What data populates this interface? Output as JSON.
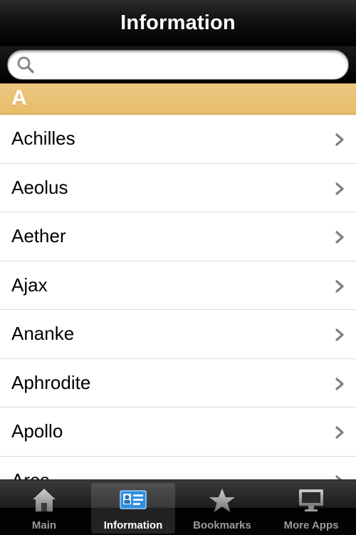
{
  "nav": {
    "title": "Information"
  },
  "search": {
    "placeholder": "",
    "value": ""
  },
  "section": {
    "letter": "A"
  },
  "list": {
    "items": [
      {
        "label": "Achilles"
      },
      {
        "label": "Aeolus"
      },
      {
        "label": "Aether"
      },
      {
        "label": "Ajax"
      },
      {
        "label": "Ananke"
      },
      {
        "label": "Aphrodite"
      },
      {
        "label": "Apollo"
      },
      {
        "label": "Ares"
      }
    ]
  },
  "tabbar": {
    "tabs": [
      {
        "label": "Main",
        "icon": "house-icon"
      },
      {
        "label": "Information",
        "icon": "contact-card-icon",
        "selected": true
      },
      {
        "label": "Bookmarks",
        "icon": "star-icon"
      },
      {
        "label": "More Apps",
        "icon": "monitor-icon"
      }
    ]
  },
  "colors": {
    "section_header": "#e6bd6a",
    "nav_background": "#000000",
    "tab_selected": "#ffffff",
    "tab_inactive": "#9a9a9a",
    "chevron": "#7f7f7f"
  }
}
